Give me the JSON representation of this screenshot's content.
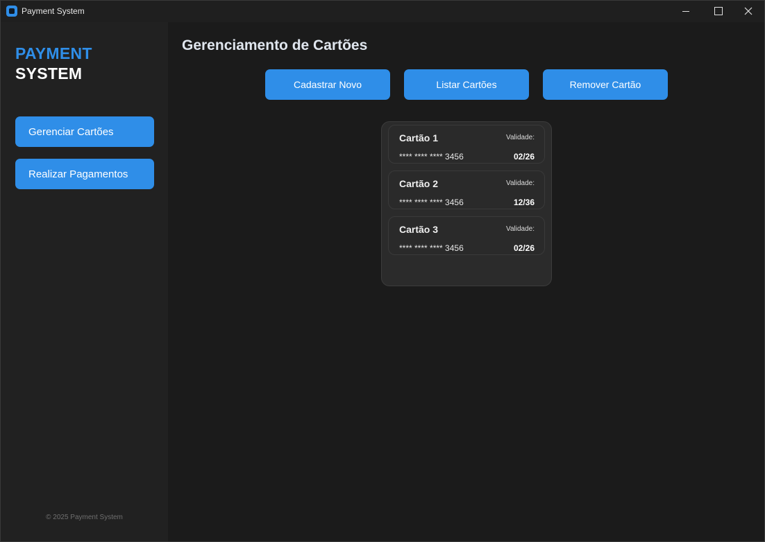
{
  "window": {
    "title": "Payment System"
  },
  "sidebar": {
    "brand_line1": "PAYMENT",
    "brand_line2": "SYSTEM",
    "items": [
      {
        "label": "Gerenciar Cartões"
      },
      {
        "label": "Realizar Pagamentos"
      }
    ],
    "footer": "© 2025 Payment System"
  },
  "main": {
    "title": "Gerenciamento de Cartões",
    "actions": [
      {
        "label": "Cadastrar Novo"
      },
      {
        "label": "Listar Cartões"
      },
      {
        "label": "Remover Cartão"
      }
    ],
    "cards": [
      {
        "name": "Cartão 1",
        "validity_label": "Validade:",
        "number": "**** **** **** 3456",
        "expiry": "02/26"
      },
      {
        "name": "Cartão 2",
        "validity_label": "Validade:",
        "number": "**** **** **** 3456",
        "expiry": "12/36"
      },
      {
        "name": "Cartão 3",
        "validity_label": "Validade:",
        "number": "**** **** **** 3456",
        "expiry": "02/26"
      }
    ]
  },
  "colors": {
    "accent": "#2f8ee8",
    "background": "#1b1b1b",
    "sidebar": "#212121",
    "card": "#2b2b2b"
  }
}
